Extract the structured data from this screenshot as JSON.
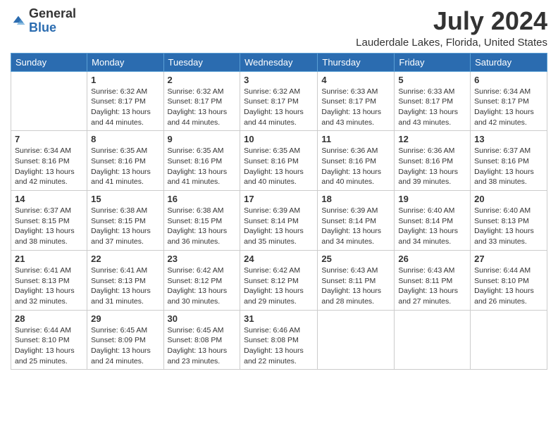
{
  "logo": {
    "general": "General",
    "blue": "Blue"
  },
  "header": {
    "month": "July 2024",
    "location": "Lauderdale Lakes, Florida, United States"
  },
  "days_of_week": [
    "Sunday",
    "Monday",
    "Tuesday",
    "Wednesday",
    "Thursday",
    "Friday",
    "Saturday"
  ],
  "weeks": [
    [
      {
        "day": "",
        "info": ""
      },
      {
        "day": "1",
        "info": "Sunrise: 6:32 AM\nSunset: 8:17 PM\nDaylight: 13 hours and 44 minutes."
      },
      {
        "day": "2",
        "info": "Sunrise: 6:32 AM\nSunset: 8:17 PM\nDaylight: 13 hours and 44 minutes."
      },
      {
        "day": "3",
        "info": "Sunrise: 6:32 AM\nSunset: 8:17 PM\nDaylight: 13 hours and 44 minutes."
      },
      {
        "day": "4",
        "info": "Sunrise: 6:33 AM\nSunset: 8:17 PM\nDaylight: 13 hours and 43 minutes."
      },
      {
        "day": "5",
        "info": "Sunrise: 6:33 AM\nSunset: 8:17 PM\nDaylight: 13 hours and 43 minutes."
      },
      {
        "day": "6",
        "info": "Sunrise: 6:34 AM\nSunset: 8:17 PM\nDaylight: 13 hours and 42 minutes."
      }
    ],
    [
      {
        "day": "7",
        "info": "Sunrise: 6:34 AM\nSunset: 8:16 PM\nDaylight: 13 hours and 42 minutes."
      },
      {
        "day": "8",
        "info": "Sunrise: 6:35 AM\nSunset: 8:16 PM\nDaylight: 13 hours and 41 minutes."
      },
      {
        "day": "9",
        "info": "Sunrise: 6:35 AM\nSunset: 8:16 PM\nDaylight: 13 hours and 41 minutes."
      },
      {
        "day": "10",
        "info": "Sunrise: 6:35 AM\nSunset: 8:16 PM\nDaylight: 13 hours and 40 minutes."
      },
      {
        "day": "11",
        "info": "Sunrise: 6:36 AM\nSunset: 8:16 PM\nDaylight: 13 hours and 40 minutes."
      },
      {
        "day": "12",
        "info": "Sunrise: 6:36 AM\nSunset: 8:16 PM\nDaylight: 13 hours and 39 minutes."
      },
      {
        "day": "13",
        "info": "Sunrise: 6:37 AM\nSunset: 8:16 PM\nDaylight: 13 hours and 38 minutes."
      }
    ],
    [
      {
        "day": "14",
        "info": "Sunrise: 6:37 AM\nSunset: 8:15 PM\nDaylight: 13 hours and 38 minutes."
      },
      {
        "day": "15",
        "info": "Sunrise: 6:38 AM\nSunset: 8:15 PM\nDaylight: 13 hours and 37 minutes."
      },
      {
        "day": "16",
        "info": "Sunrise: 6:38 AM\nSunset: 8:15 PM\nDaylight: 13 hours and 36 minutes."
      },
      {
        "day": "17",
        "info": "Sunrise: 6:39 AM\nSunset: 8:14 PM\nDaylight: 13 hours and 35 minutes."
      },
      {
        "day": "18",
        "info": "Sunrise: 6:39 AM\nSunset: 8:14 PM\nDaylight: 13 hours and 34 minutes."
      },
      {
        "day": "19",
        "info": "Sunrise: 6:40 AM\nSunset: 8:14 PM\nDaylight: 13 hours and 34 minutes."
      },
      {
        "day": "20",
        "info": "Sunrise: 6:40 AM\nSunset: 8:13 PM\nDaylight: 13 hours and 33 minutes."
      }
    ],
    [
      {
        "day": "21",
        "info": "Sunrise: 6:41 AM\nSunset: 8:13 PM\nDaylight: 13 hours and 32 minutes."
      },
      {
        "day": "22",
        "info": "Sunrise: 6:41 AM\nSunset: 8:13 PM\nDaylight: 13 hours and 31 minutes."
      },
      {
        "day": "23",
        "info": "Sunrise: 6:42 AM\nSunset: 8:12 PM\nDaylight: 13 hours and 30 minutes."
      },
      {
        "day": "24",
        "info": "Sunrise: 6:42 AM\nSunset: 8:12 PM\nDaylight: 13 hours and 29 minutes."
      },
      {
        "day": "25",
        "info": "Sunrise: 6:43 AM\nSunset: 8:11 PM\nDaylight: 13 hours and 28 minutes."
      },
      {
        "day": "26",
        "info": "Sunrise: 6:43 AM\nSunset: 8:11 PM\nDaylight: 13 hours and 27 minutes."
      },
      {
        "day": "27",
        "info": "Sunrise: 6:44 AM\nSunset: 8:10 PM\nDaylight: 13 hours and 26 minutes."
      }
    ],
    [
      {
        "day": "28",
        "info": "Sunrise: 6:44 AM\nSunset: 8:10 PM\nDaylight: 13 hours and 25 minutes."
      },
      {
        "day": "29",
        "info": "Sunrise: 6:45 AM\nSunset: 8:09 PM\nDaylight: 13 hours and 24 minutes."
      },
      {
        "day": "30",
        "info": "Sunrise: 6:45 AM\nSunset: 8:08 PM\nDaylight: 13 hours and 23 minutes."
      },
      {
        "day": "31",
        "info": "Sunrise: 6:46 AM\nSunset: 8:08 PM\nDaylight: 13 hours and 22 minutes."
      },
      {
        "day": "",
        "info": ""
      },
      {
        "day": "",
        "info": ""
      },
      {
        "day": "",
        "info": ""
      }
    ]
  ]
}
